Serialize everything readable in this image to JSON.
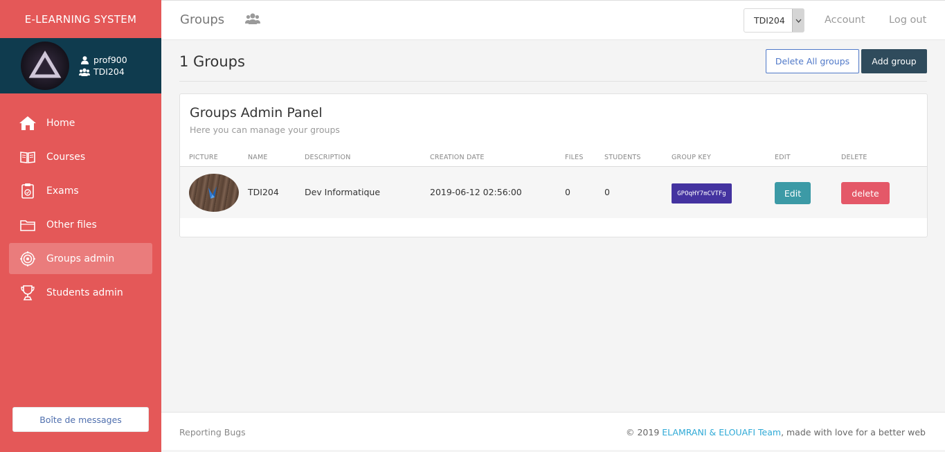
{
  "app": {
    "brand": "E-LEARNING SYSTEM"
  },
  "user": {
    "username": "prof900",
    "group": "TDI204"
  },
  "sidebar": {
    "items": [
      {
        "label": "Home",
        "icon": "home-icon"
      },
      {
        "label": "Courses",
        "icon": "book-icon"
      },
      {
        "label": "Exams",
        "icon": "clipboard-icon"
      },
      {
        "label": "Other files",
        "icon": "folder-icon"
      },
      {
        "label": "Groups admin",
        "icon": "target-icon",
        "active": true
      },
      {
        "label": "Students admin",
        "icon": "trophy-icon"
      }
    ],
    "message_button": "Boîte de messages"
  },
  "topbar": {
    "title": "Groups",
    "group_select": "TDI204",
    "account": "Account",
    "logout": "Log out"
  },
  "main": {
    "title": "1 Groups",
    "delete_all": "Delete All groups",
    "add_group": "Add group"
  },
  "panel": {
    "title": "Groups Admin Panel",
    "subtitle": "Here you can manage your groups",
    "columns": [
      "PICTURE",
      "NAME",
      "DESCRIPTION",
      "CREATION DATE",
      "FILES",
      "STUDENTS",
      "GROUP KEY",
      "EDIT",
      "DELETE"
    ],
    "rows": [
      {
        "name": "TDI204",
        "description": "Dev Informatique",
        "creation_date": "2019-06-12 02:56:00",
        "files": "0",
        "students": "0",
        "group_key": "GPOqHY7mCVTFg",
        "edit": "Edit",
        "delete": "delete"
      }
    ]
  },
  "footer": {
    "left": "Reporting Bugs",
    "copyright": "© 2019 ",
    "team": "ELAMRANI & ELOUAFI Team",
    "tagline": ", made with love for a better web"
  },
  "colors": {
    "sidebar": "#e45858",
    "user_panel": "#0f3b4e",
    "dark_button": "#2f4b5c",
    "key_badge": "#4433a0",
    "edit_button": "#3c9aa6",
    "delete_button": "#e45868",
    "team_link": "#2ea9d6"
  }
}
